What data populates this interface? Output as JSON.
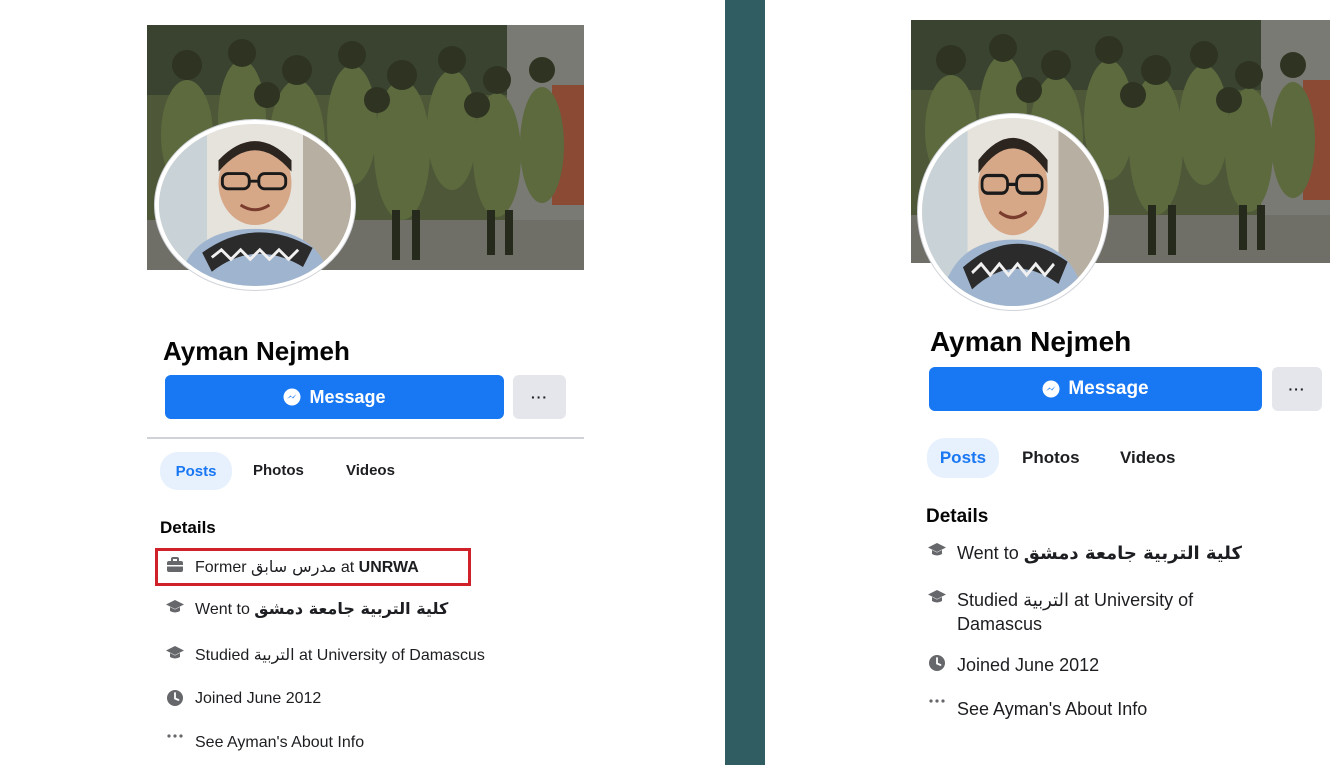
{
  "left": {
    "name": "Ayman Nejmeh",
    "message_label": "Message",
    "more_label": "···",
    "tabs": {
      "posts": "Posts",
      "photos": "Photos",
      "videos": "Videos"
    },
    "details_heading": "Details",
    "details": {
      "work_prefix": "Former",
      "work_title_ar": "مدرس سابق",
      "work_at": "at",
      "work_org": "UNRWA",
      "went_to_prefix": "Went to",
      "went_to_ar": "كلية التربية جامعة دمشق",
      "studied_prefix": "Studied",
      "studied_ar": "التربية",
      "studied_suffix": "at University of Damascus",
      "joined": "Joined June 2012",
      "see_about": "See Ayman's About Info"
    }
  },
  "right": {
    "name": "Ayman Nejmeh",
    "message_label": "Message",
    "more_label": "···",
    "tabs": {
      "posts": "Posts",
      "photos": "Photos",
      "videos": "Videos"
    },
    "details_heading": "Details",
    "details": {
      "went_to_prefix": "Went to",
      "went_to_ar": "كلية التربية جامعة دمشق",
      "studied_prefix": "Studied",
      "studied_ar": "التربية",
      "studied_suffix_line1": "at University of",
      "studied_suffix_line2": "Damascus",
      "joined": "Joined June 2012",
      "see_about": "See Ayman's About Info"
    }
  },
  "icons": {
    "messenger": "messenger-icon",
    "briefcase": "briefcase-icon",
    "graduation": "graduation-cap-icon",
    "clock": "clock-icon",
    "more": "ellipsis-icon"
  },
  "colors": {
    "accent": "#1877f2",
    "tab_active_bg": "#e7f0fd",
    "highlight": "#d0202a",
    "divider": "#2f5d62",
    "secondary_button": "#e4e6eb"
  }
}
